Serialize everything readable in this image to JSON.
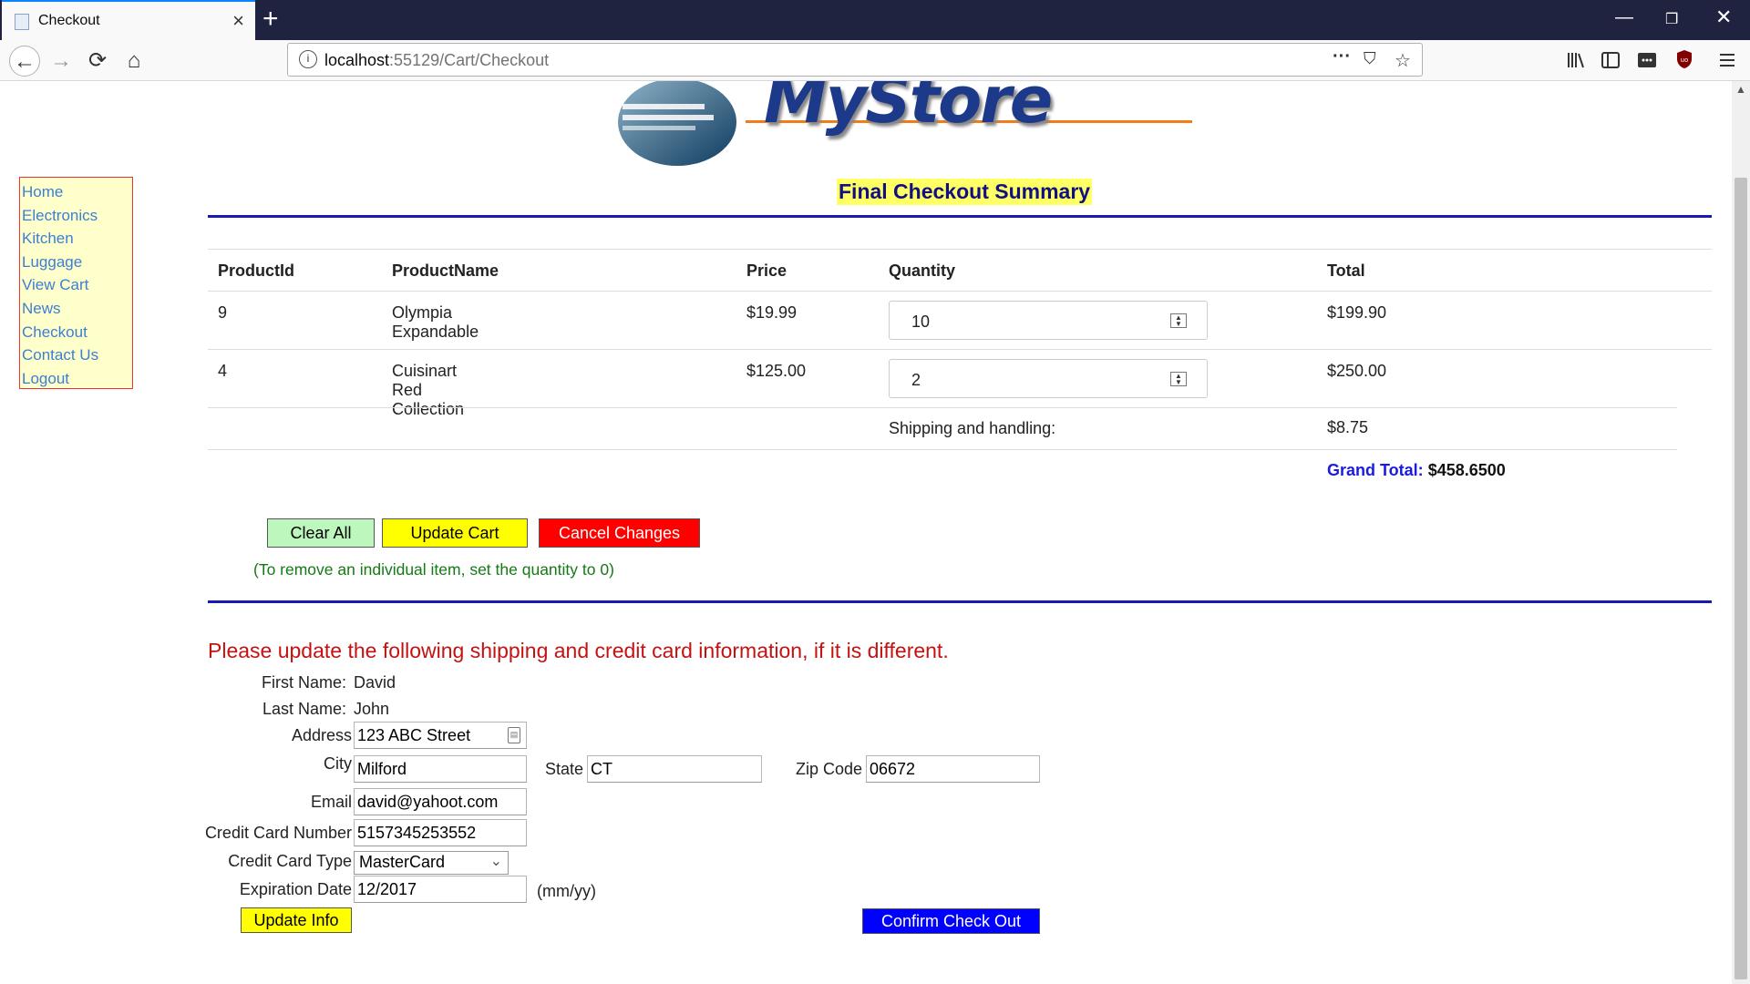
{
  "browser": {
    "tab_title": "Checkout",
    "url_host": "localhost",
    "url_path": ":55129/Cart/Checkout"
  },
  "logo": {
    "text": "MyStore"
  },
  "sidebar": {
    "items": [
      {
        "label": "Home"
      },
      {
        "label": "Electronics"
      },
      {
        "label": "Kitchen"
      },
      {
        "label": "Luggage"
      },
      {
        "label": "View Cart"
      },
      {
        "label": "News"
      },
      {
        "label": "Checkout"
      },
      {
        "label": "Contact Us"
      },
      {
        "label": "Logout"
      }
    ]
  },
  "summary": {
    "title": "Final Checkout Summary",
    "columns": [
      "ProductId",
      "ProductName",
      "Price",
      "Quantity",
      "Total"
    ],
    "rows": [
      {
        "id": "9",
        "name": "Olympia Expandable",
        "price": "$19.99",
        "qty": "10",
        "total": "$199.90"
      },
      {
        "id": "4",
        "name": "Cuisinart Red Collection",
        "price": "$125.00",
        "qty": "2",
        "total": "$250.00"
      }
    ],
    "shipping_label": "Shipping and handling:",
    "shipping_value": "$8.75",
    "grand_total_label": "Grand Total:",
    "grand_total_value": "$458.6500"
  },
  "cart_buttons": {
    "clear_all": "Clear All",
    "update_cart": "Update Cart",
    "cancel_changes": "Cancel Changes",
    "note": "(To remove an individual item, set the quantity to 0)"
  },
  "shipping_form": {
    "heading": "Please update the following shipping and credit card information, if it is different.",
    "first_name_label": "First Name:",
    "first_name": "David",
    "last_name_label": "Last Name:",
    "last_name": "John",
    "address_label": "Address",
    "address": "123 ABC Street",
    "city_label": "City",
    "city": "Milford",
    "state_label": "State",
    "state": "CT",
    "zip_label": "Zip Code",
    "zip": "06672",
    "email_label": "Email",
    "email": "david@yahoot.com",
    "cc_number_label": "Credit Card Number",
    "cc_number": "5157345253552",
    "cc_type_label": "Credit Card Type",
    "cc_type": "MasterCard",
    "exp_label": "Expiration Date",
    "exp": "12/2017",
    "exp_hint": "(mm/yy)",
    "update_info": "Update Info",
    "confirm_checkout": "Confirm Check Out"
  }
}
